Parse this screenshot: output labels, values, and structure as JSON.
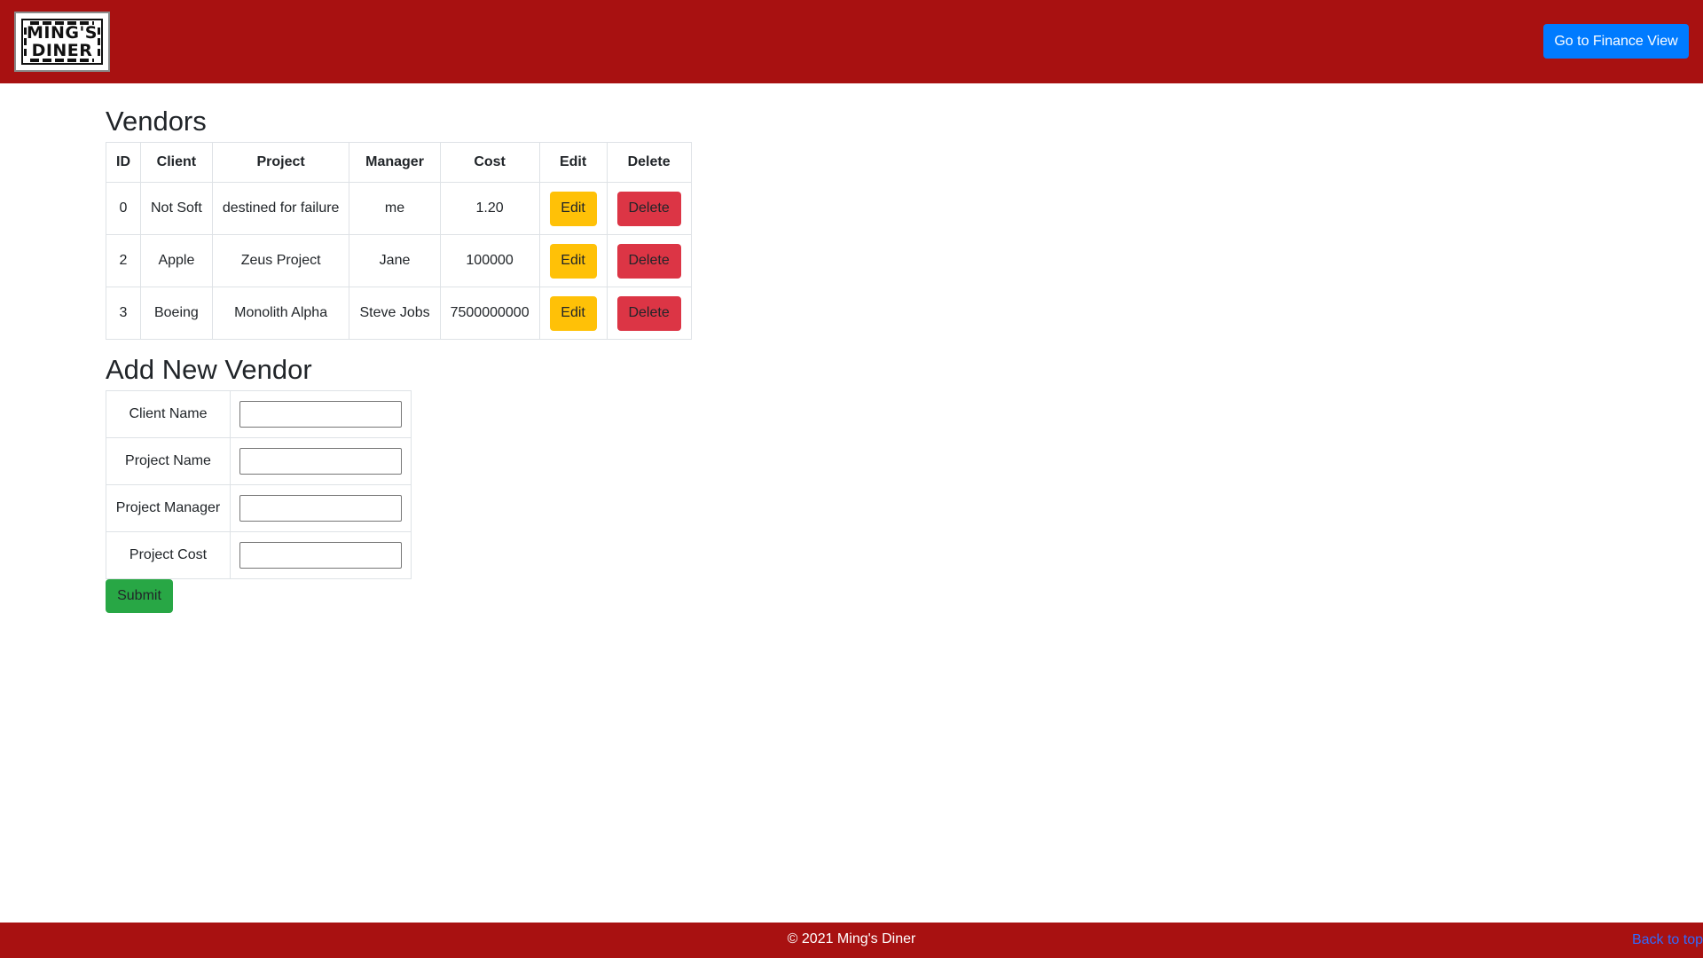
{
  "header": {
    "logo": {
      "line1": "MING'S",
      "line2": "DINER"
    },
    "finance_button_label": "Go to Finance View",
    "colors": {
      "bar": "#a81111",
      "primary_button": "#007bff"
    }
  },
  "vendors": {
    "title": "Vendors",
    "columns": [
      "ID",
      "Client",
      "Project",
      "Manager",
      "Cost",
      "Edit",
      "Delete"
    ],
    "rows": [
      {
        "id": "0",
        "client": "Not Soft",
        "project": "destined for failure",
        "manager": "me",
        "cost": "1.20",
        "edit_label": "Edit",
        "delete_label": "Delete"
      },
      {
        "id": "2",
        "client": "Apple",
        "project": "Zeus Project",
        "manager": "Jane",
        "cost": "100000",
        "edit_label": "Edit",
        "delete_label": "Delete"
      },
      {
        "id": "3",
        "client": "Boeing",
        "project": "Monolith Alpha",
        "manager": "Steve Jobs",
        "cost": "7500000000",
        "edit_label": "Edit",
        "delete_label": "Delete"
      }
    ],
    "colors": {
      "edit": "#ffc107",
      "delete": "#dc3545"
    }
  },
  "add_vendor": {
    "title": "Add New Vendor",
    "fields": [
      {
        "label": "Client Name",
        "value": ""
      },
      {
        "label": "Project Name",
        "value": ""
      },
      {
        "label": "Project Manager",
        "value": ""
      },
      {
        "label": "Project Cost",
        "value": ""
      }
    ],
    "submit_label": "Submit",
    "submit_color": "#28a745"
  },
  "footer": {
    "copyright": "© 2021 Ming's Diner",
    "back_to_top": "Back to top"
  }
}
